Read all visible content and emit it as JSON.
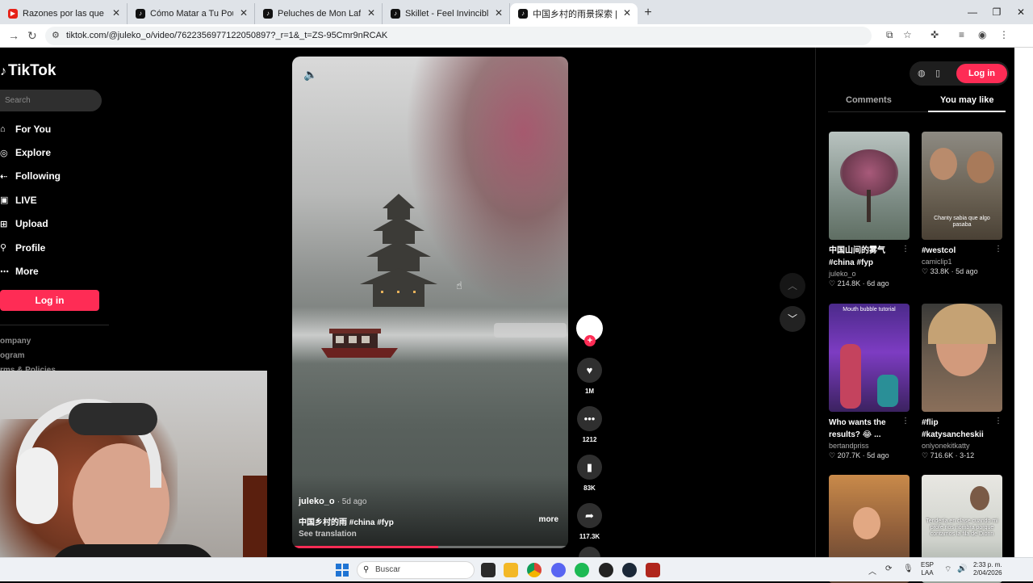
{
  "browser": {
    "tabs": [
      {
        "label": "Razones por las que no contest"
      },
      {
        "label": "Cómo Matar a Tu Pou: Humor y"
      },
      {
        "label": "Peluches de Mon Laferte y tuto"
      },
      {
        "label": "Skillet - Feel Invincible | Rock Ar"
      },
      {
        "label": "中国乡村的雨景探索 | TikTok"
      }
    ],
    "url": "tiktok.com/@juleko_o/video/7622356977122050897?_r=1&_t=ZS-95Cmr9nRCAK"
  },
  "sidebar": {
    "logo": "TikTok",
    "search_placeholder": "Search",
    "nav": [
      {
        "label": "For You",
        "icon": "home-icon"
      },
      {
        "label": "Explore",
        "icon": "compass-icon"
      },
      {
        "label": "Following",
        "icon": "following-icon"
      },
      {
        "label": "LIVE",
        "icon": "live-icon"
      },
      {
        "label": "Upload",
        "icon": "upload-icon"
      },
      {
        "label": "Profile",
        "icon": "profile-icon"
      },
      {
        "label": "More",
        "icon": "more-icon"
      }
    ],
    "login_label": "Log in",
    "footer_links": [
      "ompany",
      "ogram",
      "rms & Policies"
    ]
  },
  "video": {
    "author": "juleko_o",
    "age": "· 5d ago",
    "caption": "中国乡村的雨 #china #fyp",
    "more_label": "more",
    "see_translation": "See translation",
    "progress": 0.53
  },
  "actions": {
    "likes": "1M",
    "comments": "1212",
    "saves": "83K",
    "shares": "117.3K"
  },
  "right_panel": {
    "login_label": "Log in",
    "tabs": {
      "comments": "Comments",
      "you_may_like": "You may like"
    },
    "cards": [
      {
        "title": "中国山间的雾气 #china #fyp",
        "user": "juleko_o",
        "likes": "214.8K",
        "age": "6d ago",
        "thumb_text": ""
      },
      {
        "title": "#westcol",
        "user": "camiclip1",
        "likes": "33.8K",
        "age": "5d ago",
        "thumb_text": "Chanty sabia que algo pasaba"
      },
      {
        "title": "Who wants the results? 😂 ...",
        "user": "bertandpriss",
        "likes": "207.7K",
        "age": "5d ago",
        "thumb_text": "Mouth bubble tutorial"
      },
      {
        "title": "#flip #katysancheskii",
        "user": "onlyonekitkatty",
        "likes": "716.6K",
        "age": "3-12",
        "thumb_text": ""
      },
      {
        "title": "",
        "user": "",
        "likes": "",
        "age": "",
        "thumb_text": ""
      },
      {
        "title": "",
        "user": "",
        "likes": "",
        "age": "",
        "thumb_text": "Tendería en clase cuando mi profe nos nombra porque contamos la fila de Dionn"
      }
    ]
  },
  "taskbar": {
    "search_label": "Buscar",
    "lang_top": "ESP",
    "lang_bottom": "LAA",
    "time": "2:33 p. m.",
    "date": "2/04/2026"
  }
}
